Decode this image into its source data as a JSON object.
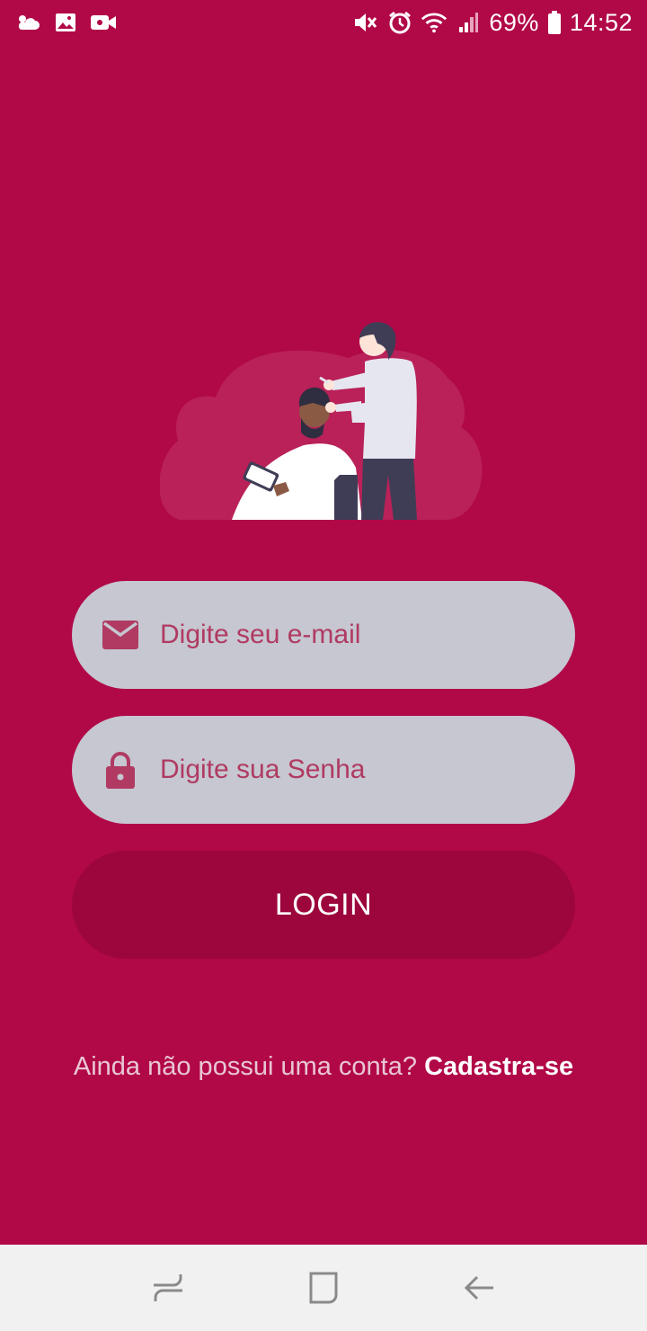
{
  "status_bar": {
    "left_icons": [
      "weather-icon",
      "gallery-icon",
      "video-camera-icon"
    ],
    "right_icons": [
      "mute-icon",
      "alarm-icon",
      "wifi-icon",
      "signal-icon",
      "battery-icon"
    ],
    "battery_percent": "69%",
    "time": "14:52"
  },
  "illustration": {
    "icon": "barber-illustration"
  },
  "form": {
    "email_placeholder": "Digite seu e-mail",
    "email_value": "",
    "email_icon": "mail-icon",
    "password_placeholder": "Digite sua Senha",
    "password_value": "",
    "password_icon": "lock-icon",
    "login_label": "LOGIN"
  },
  "signup": {
    "prompt": "Ainda não possui uma conta?",
    "link": "Cadastra-se"
  },
  "nav_bar": {
    "items": [
      "recents-icon",
      "home-icon",
      "back-icon"
    ]
  },
  "colors": {
    "background": "#b10848",
    "field": "#c6c7d0",
    "field_text": "#b03a62",
    "button": "#9c063c",
    "cloud": "#b92158"
  }
}
